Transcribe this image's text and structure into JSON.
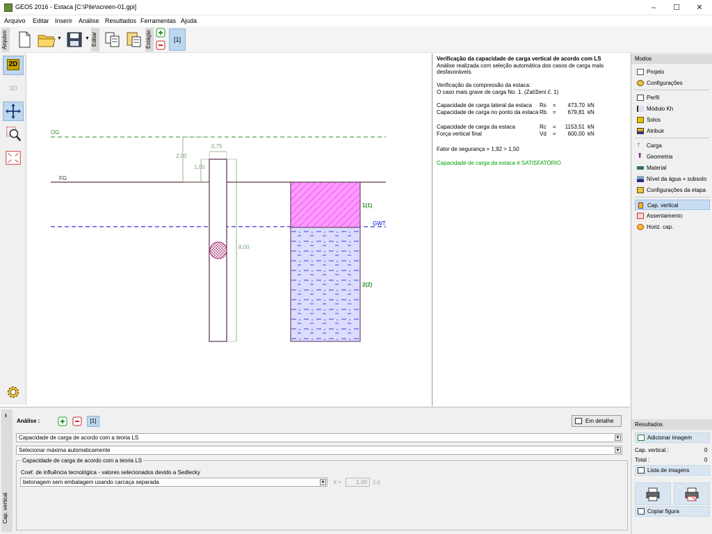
{
  "window": {
    "title": "GEO5 2016 - Estaca [C:\\Pile\\screen-01.gpi]",
    "minimize": "–",
    "maximize": "☐",
    "close": "✕"
  },
  "menu": [
    "Arquivo",
    "Editar",
    "Inserir",
    "Análise",
    "Resultados",
    "Ferramentas",
    "Ajuda"
  ],
  "toolbar": {
    "arquivo_label": "Arquivo",
    "editar_label": "Editar",
    "estagio_label": "Estágio",
    "stage_number": "[1]"
  },
  "left_toolbar": {
    "mode_2d": "2D",
    "mode_3d": "3D"
  },
  "drawing": {
    "og_label": "OG",
    "fg_label": "FG",
    "gwt_label": "GWT",
    "dim_2": "2,00",
    "dim_1": "1,00",
    "dim_075": "0,75",
    "dim_8": "8,00",
    "layer1": "1(1)",
    "layer2": "2(2)"
  },
  "results": {
    "title": "Verificação da capacidade de carga vertical de acordo com LS",
    "subtitle1": "Análise realizada com seleção automática dos casos de carga mais",
    "subtitle2": "desfavoráveis.",
    "comp_title": "Verificação da compressão da estaca:",
    "comp_case": "O caso mais grave de carga No. 1. (Zatížení č. 1)",
    "rows": [
      {
        "label": "Capacidade de carga lateral da estaca",
        "sym": "Rs",
        "eq": "=",
        "value": "473,70",
        "unit": "kN"
      },
      {
        "label": "Capacidade de carga no ponto da estaca",
        "sym": "Rb",
        "eq": "=",
        "value": "679,81",
        "unit": "kN"
      },
      {
        "label": "Capacidade de carga da estaca",
        "sym": "Rc",
        "eq": "=",
        "value": "1153,51",
        "unit": "kN"
      },
      {
        "label": "Força vertical final",
        "sym": "Vd",
        "eq": "=",
        "value": "600,00",
        "unit": "kN"
      }
    ],
    "safety": "Fator de segurança = 1,92 > 1,50",
    "verdict": "Capacidade de carga da estaca é SATISFATÓRIO",
    "verdict_color": "#00a000"
  },
  "modes": {
    "header": "Modos",
    "items": [
      "Projeto",
      "Configurações",
      "Perfil",
      "Módulo Kh",
      "Solos",
      "Atribuir",
      "Carga",
      "Geometria",
      "Material",
      "Nível da água + subsolo",
      "Configurações da etapa",
      "Cap. vertical",
      "Assentamento",
      "Horiz. cap."
    ],
    "active": "Cap. vertical"
  },
  "analysis": {
    "label": "Análise :",
    "stage": "[1]",
    "detail_button": "Em detalhe",
    "method_select": "Capacidade de carga de acordo com a teoria LS",
    "auto_select": "Selecionar máxima automaticamente",
    "group_title": "Capacidade de carga de acordo com a teoria LS",
    "coef_label": "Coef. de influência tecnológica - valores selecionados devido a Sedlecky",
    "tech_select": "betonagem sem embalagem usando carcaça separada",
    "k_label": "k =",
    "k_value": "1,00",
    "k_unit": "[–]",
    "side_tab": "Cap. vertical"
  },
  "results_panel": {
    "header": "Resultados",
    "add_image": "Adicionar imagem",
    "cap_vertical_label": "Cap. vertical :",
    "cap_vertical_value": "0",
    "total_label": "Total :",
    "total_value": "0",
    "image_list": "Lista de imagens",
    "copy_figure": "Copiar figura"
  },
  "colors": {
    "accent": "#bcd7ef",
    "soil1": "#ff66ff",
    "soil2": "#ddddff",
    "gwt": "#0000cc",
    "og": "#338833",
    "dim": "#7aa07a"
  }
}
